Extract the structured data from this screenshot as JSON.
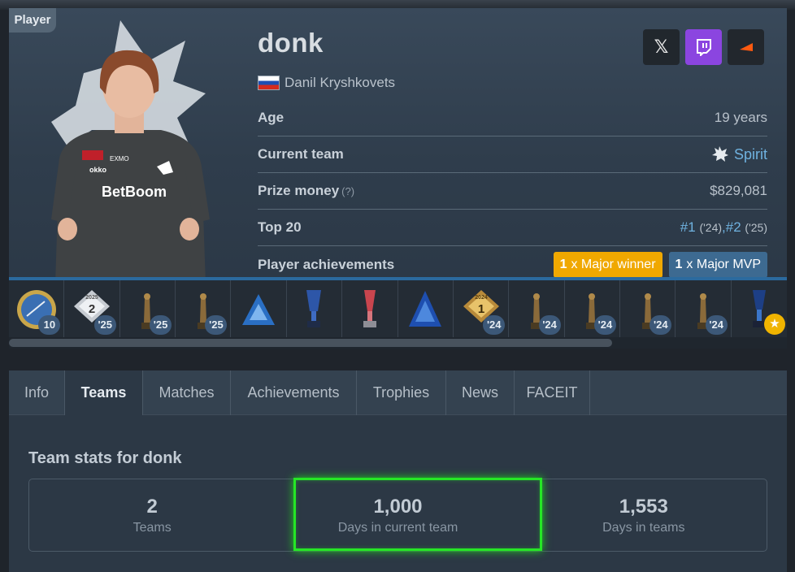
{
  "card": {
    "tag": "Player",
    "nickname": "donk",
    "real_name": "Danil Kryshkovets",
    "socials": [
      {
        "name": "x-icon",
        "glyph": "𝕏"
      },
      {
        "name": "twitch-icon",
        "glyph": "▣"
      },
      {
        "name": "faceit-icon",
        "glyph": "◢"
      }
    ],
    "rows": {
      "age_label": "Age",
      "age_value": "19 years",
      "team_label": "Current team",
      "team_value": "Spirit",
      "prize_label": "Prize money",
      "prize_hint": "(?)",
      "prize_value": "$829,081",
      "top20_label": "Top 20",
      "top20_rank1": "#1",
      "top20_year1": "('24)",
      "top20_sep": ",",
      "top20_rank2": "#2",
      "top20_year2": "('25)",
      "achievements_label": "Player achievements",
      "major_winner_count": "1",
      "major_winner_text": "x Major winner",
      "major_mvp_count": "1",
      "major_mvp_text": "x Major MVP"
    }
  },
  "trophies": [
    {
      "badge": "10"
    },
    {
      "badge": "'25",
      "top": "2025",
      "place": "2"
    },
    {
      "badge": "'25"
    },
    {
      "badge": "'25"
    },
    {
      "badge": ""
    },
    {
      "badge": ""
    },
    {
      "badge": ""
    },
    {
      "badge": ""
    },
    {
      "badge": "'24",
      "top": "2024",
      "place": "1"
    },
    {
      "badge": "'24"
    },
    {
      "badge": "'24"
    },
    {
      "badge": "'24"
    },
    {
      "badge": "'24"
    },
    {
      "badge": "★"
    }
  ],
  "tabs": [
    "Info",
    "Teams",
    "Matches",
    "Achievements",
    "Trophies",
    "News",
    "FACEIT"
  ],
  "active_tab": "Teams",
  "team_stats": {
    "title": "Team stats for donk",
    "teams_count": "2",
    "teams_caption": "Teams",
    "current_days": "1,000",
    "current_caption": "Days in current team",
    "total_days": "1,553",
    "total_caption": "Days in teams"
  },
  "colors": {
    "accent_link": "#6fb2e0",
    "major_winner": "#f0a800",
    "major_mvp": "#3d6a91",
    "highlight": "#26e626"
  }
}
